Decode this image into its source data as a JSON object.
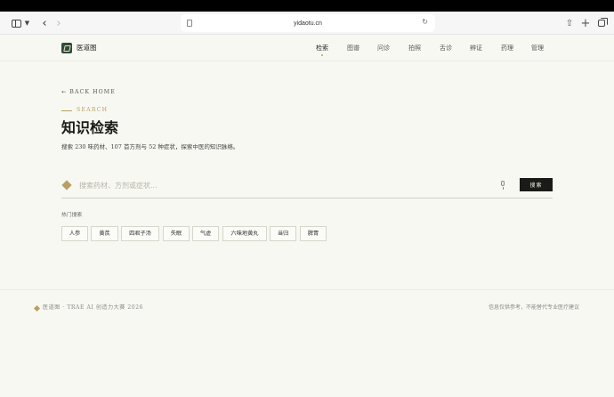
{
  "browser": {
    "url": "yidaotu.cn"
  },
  "site": {
    "name": "医道图",
    "nav": [
      {
        "label": "检索",
        "active": true
      },
      {
        "label": "图谱",
        "active": false
      },
      {
        "label": "问诊",
        "active": false
      },
      {
        "label": "拍照",
        "active": false
      },
      {
        "label": "舌诊",
        "active": false
      },
      {
        "label": "辨证",
        "active": false
      },
      {
        "label": "药理",
        "active": false
      },
      {
        "label": "管理",
        "active": false
      }
    ]
  },
  "main": {
    "back_label": "BACK HOME",
    "eyebrow": "SEARCH",
    "title": "知识检索",
    "subtitle": "搜索 230 味药材、107 首方剂与 52 种症状，探索中医的知识脉络。",
    "search": {
      "placeholder": "搜索药材、方剂或症状...",
      "value": "",
      "button_label": "搜索"
    },
    "hot_label": "热门搜索",
    "hot_tags": [
      "人参",
      "黄芪",
      "四君子汤",
      "失眠",
      "气虚",
      "六味地黄丸",
      "当归",
      "脾胃"
    ]
  },
  "footer": {
    "left": "医道图 · TRAE AI 创造力大赛 2026",
    "right": "信息仅供参考，不能替代专业医疗建议"
  },
  "colors": {
    "accent_gold": "#b8a065",
    "brand_green": "#2f4d3a",
    "background": "#f8f8f2",
    "button_dark": "#1a1a18"
  }
}
